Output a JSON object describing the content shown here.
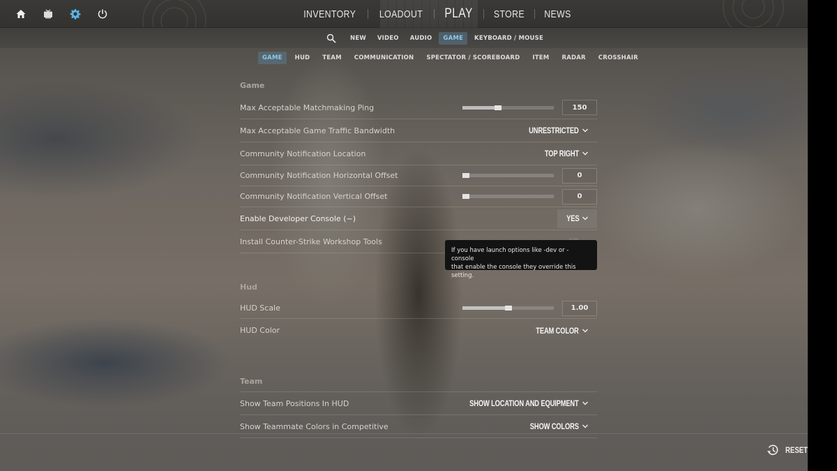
{
  "topbar": {
    "left_icons": [
      {
        "name": "home-icon",
        "label": "Home"
      },
      {
        "name": "tv-icon",
        "label": "Watch"
      },
      {
        "name": "gear-icon",
        "label": "Settings",
        "active": true
      },
      {
        "name": "power-icon",
        "label": "Quit"
      }
    ],
    "nav": [
      {
        "label": "INVENTORY"
      },
      {
        "label": "LOADOUT"
      },
      {
        "label": "PLAY"
      },
      {
        "label": "STORE"
      },
      {
        "label": "NEWS"
      }
    ]
  },
  "settings_tabs": [
    {
      "label": "NEW"
    },
    {
      "label": "VIDEO"
    },
    {
      "label": "AUDIO"
    },
    {
      "label": "GAME",
      "active": true
    },
    {
      "label": "KEYBOARD / MOUSE"
    }
  ],
  "category_tabs": [
    {
      "label": "GAME",
      "active": true
    },
    {
      "label": "HUD"
    },
    {
      "label": "TEAM"
    },
    {
      "label": "COMMUNICATION"
    },
    {
      "label": "SPECTATOR / SCOREBOARD"
    },
    {
      "label": "ITEM"
    },
    {
      "label": "RADAR"
    },
    {
      "label": "CROSSHAIR"
    }
  ],
  "sections": {
    "game": {
      "title": "Game",
      "rows": [
        {
          "label": "Max Acceptable Matchmaking Ping",
          "type": "slider",
          "value": "150",
          "fraction": 0.39
        },
        {
          "label": "Max Acceptable Game Traffic Bandwidth",
          "type": "dropdown",
          "value": "UNRESTRICTED"
        },
        {
          "label": "Community Notification Location",
          "type": "dropdown",
          "value": "TOP RIGHT"
        },
        {
          "label": "Community Notification Horizontal Offset",
          "type": "slider",
          "value": "0",
          "fraction": 0.04
        },
        {
          "label": "Community Notification Vertical Offset",
          "type": "slider",
          "value": "0",
          "fraction": 0.04
        },
        {
          "label": "Enable Developer Console (~)",
          "type": "dropdown",
          "value": "YES"
        },
        {
          "label": "Install Counter-Strike Workshop Tools",
          "type": "dropdown",
          "value": "NO"
        }
      ]
    },
    "hud": {
      "title": "Hud",
      "rows": [
        {
          "label": "HUD Scale",
          "type": "slider",
          "value": "1.00",
          "fraction": 0.5
        },
        {
          "label": "HUD Color",
          "type": "dropdown",
          "value": "TEAM COLOR"
        }
      ]
    },
    "team": {
      "title": "Team",
      "rows": [
        {
          "label": "Show Team Positions In HUD",
          "type": "dropdown",
          "value": "SHOW LOCATION AND EQUIPMENT"
        },
        {
          "label": "Show Teammate Colors in Competitive",
          "type": "dropdown",
          "value": "SHOW COLORS"
        }
      ]
    }
  },
  "tooltip": {
    "line1": "If you have launch options like -dev or -console",
    "line2": "that enable the console they override this setting."
  },
  "reset_label": "RESET",
  "colors": {
    "accent": "#5ab4e6",
    "active_tab_text": "#8cc8ea",
    "tooltip_bg": "#131313"
  }
}
